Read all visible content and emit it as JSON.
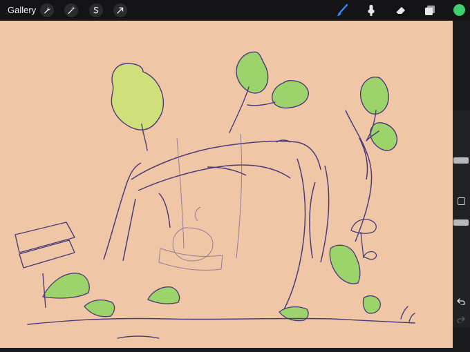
{
  "topbar": {
    "gallery_label": "Gallery",
    "left_tools": [
      "wrench-icon",
      "magic-wand-icon",
      "selection-icon",
      "transform-arrow-icon"
    ],
    "right_tools": [
      "brush-icon",
      "smudge-icon",
      "eraser-icon",
      "layers-icon"
    ],
    "accent_color": "#2d8cff",
    "current_color": "#3fcf6e"
  },
  "canvas": {
    "background": "#f0c7a6",
    "ink": "#4a3a7a",
    "leaf_green": "#9cd36a",
    "leaf_yellow": "#d8e07a"
  },
  "sidebar": {
    "controls": [
      "brush-size-slider",
      "modify-button",
      "opacity-slider",
      "undo-icon",
      "redo-icon"
    ]
  }
}
